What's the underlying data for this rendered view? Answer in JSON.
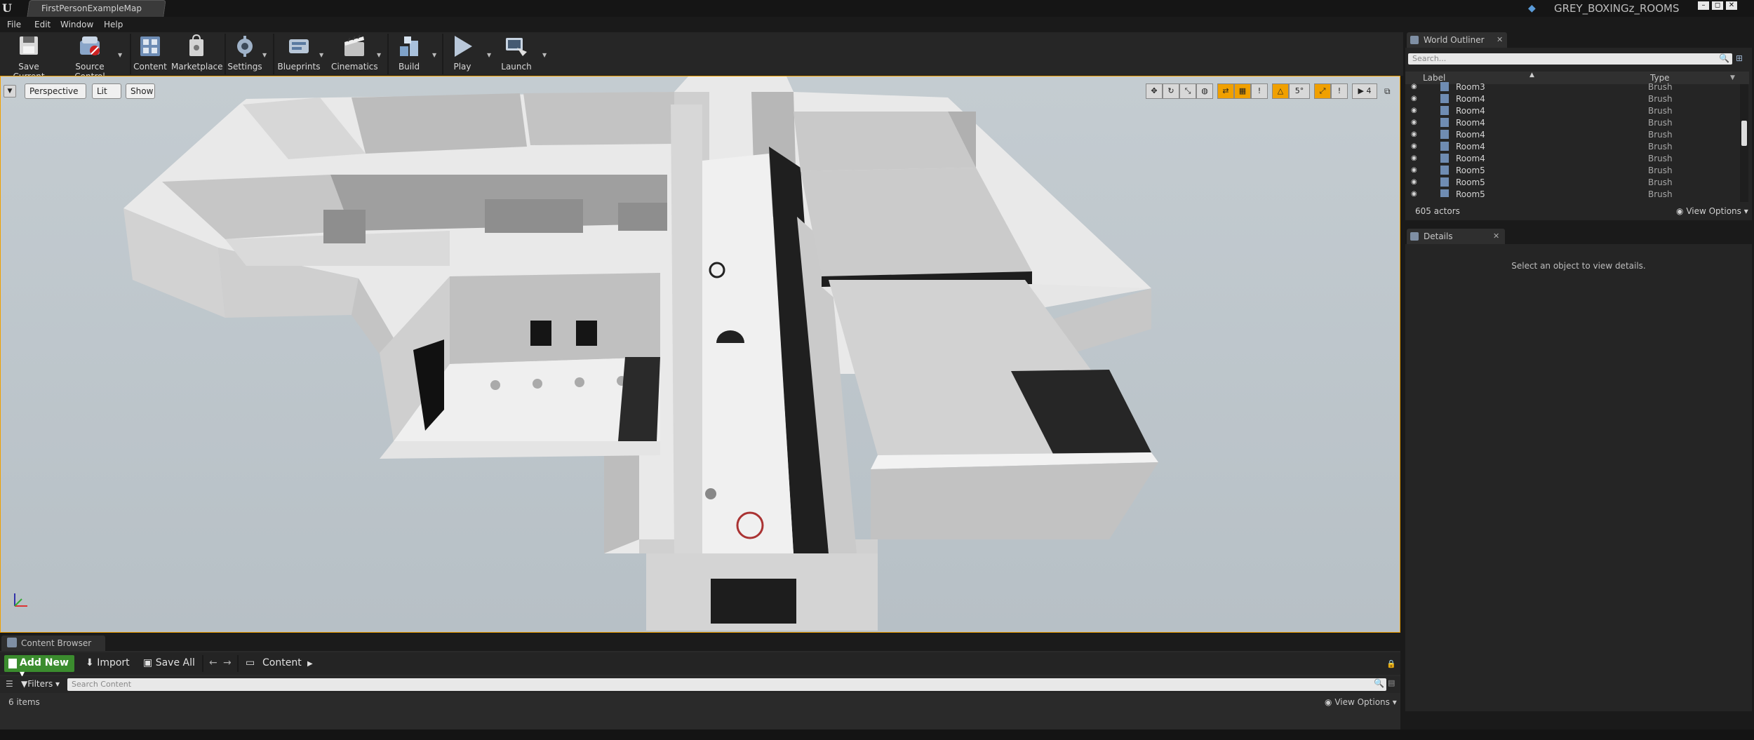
{
  "window": {
    "logo": "U",
    "document_tab": "FirstPersonExampleMap",
    "project_name": "GREY_BOXINGz_ROOMS",
    "controls": [
      "–",
      "◻",
      "✕"
    ]
  },
  "menu": [
    "File",
    "Edit",
    "Window",
    "Help"
  ],
  "toolbar": {
    "items": [
      {
        "label": "Save Current",
        "icon": "save-icon",
        "dropdown": false
      },
      {
        "label": "Source Control",
        "icon": "source-control-icon",
        "dropdown": true
      },
      {
        "label": "Content",
        "icon": "content-icon",
        "dropdown": false
      },
      {
        "label": "Marketplace",
        "icon": "marketplace-icon",
        "dropdown": false
      },
      {
        "label": "Settings",
        "icon": "settings-icon",
        "dropdown": true
      },
      {
        "label": "Blueprints",
        "icon": "blueprints-icon",
        "dropdown": true
      },
      {
        "label": "Cinematics",
        "icon": "cinematics-icon",
        "dropdown": true
      },
      {
        "label": "Build",
        "icon": "build-icon",
        "dropdown": true
      },
      {
        "label": "Play",
        "icon": "play-icon",
        "dropdown": true
      },
      {
        "label": "Launch",
        "icon": "launch-icon",
        "dropdown": true
      }
    ]
  },
  "viewport": {
    "view_mode": "Perspective",
    "lighting": "Lit",
    "show": "Show",
    "snap_angle": "5°",
    "camera_speed": "4",
    "right_tool_icons": [
      "translate-icon",
      "rotate-icon",
      "scale-icon",
      "world-local-icon",
      "surface-snap-icon",
      "grid-snap-icon",
      "grid-size-icon",
      "rotation-snap-icon",
      "rotation-size-icon",
      "scale-snap-icon",
      "scale-size-icon",
      "camera-speed-icon"
    ]
  },
  "content_browser": {
    "tab_label": "Content Browser",
    "add_new": "Add New",
    "import": "Import",
    "save_all": "Save All",
    "path": "Content",
    "filters": "Filters",
    "search_placeholder": "Search Content",
    "item_count": "6 items",
    "view_options": "View Options"
  },
  "world_outliner": {
    "tab_label": "World Outliner",
    "search_placeholder": "Search...",
    "columns": {
      "label": "Label",
      "type": "Type"
    },
    "rows": [
      {
        "label": "Room3",
        "type": "Brush"
      },
      {
        "label": "Room4",
        "type": "Brush"
      },
      {
        "label": "Room4",
        "type": "Brush"
      },
      {
        "label": "Room4",
        "type": "Brush"
      },
      {
        "label": "Room4",
        "type": "Brush"
      },
      {
        "label": "Room4",
        "type": "Brush"
      },
      {
        "label": "Room4",
        "type": "Brush"
      },
      {
        "label": "Room5",
        "type": "Brush"
      },
      {
        "label": "Room5",
        "type": "Brush"
      },
      {
        "label": "Room5",
        "type": "Brush"
      }
    ],
    "actor_count": "605 actors",
    "view_options": "View Options"
  },
  "details": {
    "tab_label": "Details",
    "empty_message": "Select an object to view details."
  },
  "colors": {
    "accent_green": "#3b8c2e",
    "selection_orange": "#f0a000",
    "panel_bg": "#252525"
  }
}
